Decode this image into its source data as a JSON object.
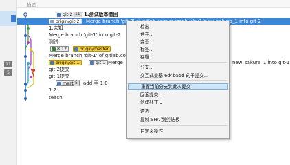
{
  "header": {
    "column_label": "描述"
  },
  "sidebar": {
    "badges": [
      "11",
      "5"
    ]
  },
  "commits": [
    {
      "refs": [
        {
          "label": "git-2",
          "style": "plain"
        },
        {
          "label": "11",
          "style": "count"
        }
      ],
      "message": "1.测试版本撤回"
    },
    {
      "refs": [
        {
          "label": "origin/git-2",
          "style": "sel"
        }
      ],
      "message": "Merge branch 'git-2' of gitlab.com:momohushu1/new_sakura_1 into git-2"
    },
    {
      "refs": [],
      "message": "1.未知"
    },
    {
      "refs": [],
      "message": "Merge branch 'git-1' into git-2"
    },
    {
      "refs": [],
      "message": "测试"
    },
    {
      "refs": [
        {
          "label": "8.12",
          "style": "tag"
        },
        {
          "label": "origin/master",
          "style": "hl"
        }
      ],
      "message": ""
    },
    {
      "refs": [],
      "message": "Merge branch 'git-1' of gitlab.com"
    },
    {
      "refs": [
        {
          "label": "origin/git-1",
          "style": "hl"
        },
        {
          "label": "git-1",
          "style": "plain"
        }
      ],
      "message": "Merge",
      "message_tail": "new_sakura_1 into git-1"
    },
    {
      "refs": [],
      "message": "git-2提交"
    },
    {
      "refs": [],
      "message": "git-1提交"
    },
    {
      "refs": [
        {
          "label": "master",
          "style": "plain"
        },
        {
          "label": "5",
          "style": "count"
        }
      ],
      "message": "add 手 1.0"
    },
    {
      "refs": [],
      "message": "1.2"
    },
    {
      "refs": [],
      "message": "teach"
    }
  ],
  "context_menu": {
    "items": [
      "检出...",
      "合并...",
      "变基...",
      "标签...",
      "存档...",
      "分支...",
      "交互式变基 6d4b55d 的子提交...",
      "重置当前分支到此次提交",
      "回滚提交...",
      "创建补丁...",
      "遴选",
      "复制 SHA 到剪贴板",
      "自定义操作"
    ],
    "hovered": "重置当前分支到此次提交"
  },
  "colors": {
    "selection": "#3b86d8",
    "menu_hover": "#cce4f7",
    "ref_highlight": "#f5ce3b",
    "graph_lines": [
      "#2a62b8",
      "#3e9e3e",
      "#b43fc4",
      "#d7c32a",
      "#2aa9c8",
      "#d23b3b"
    ]
  }
}
